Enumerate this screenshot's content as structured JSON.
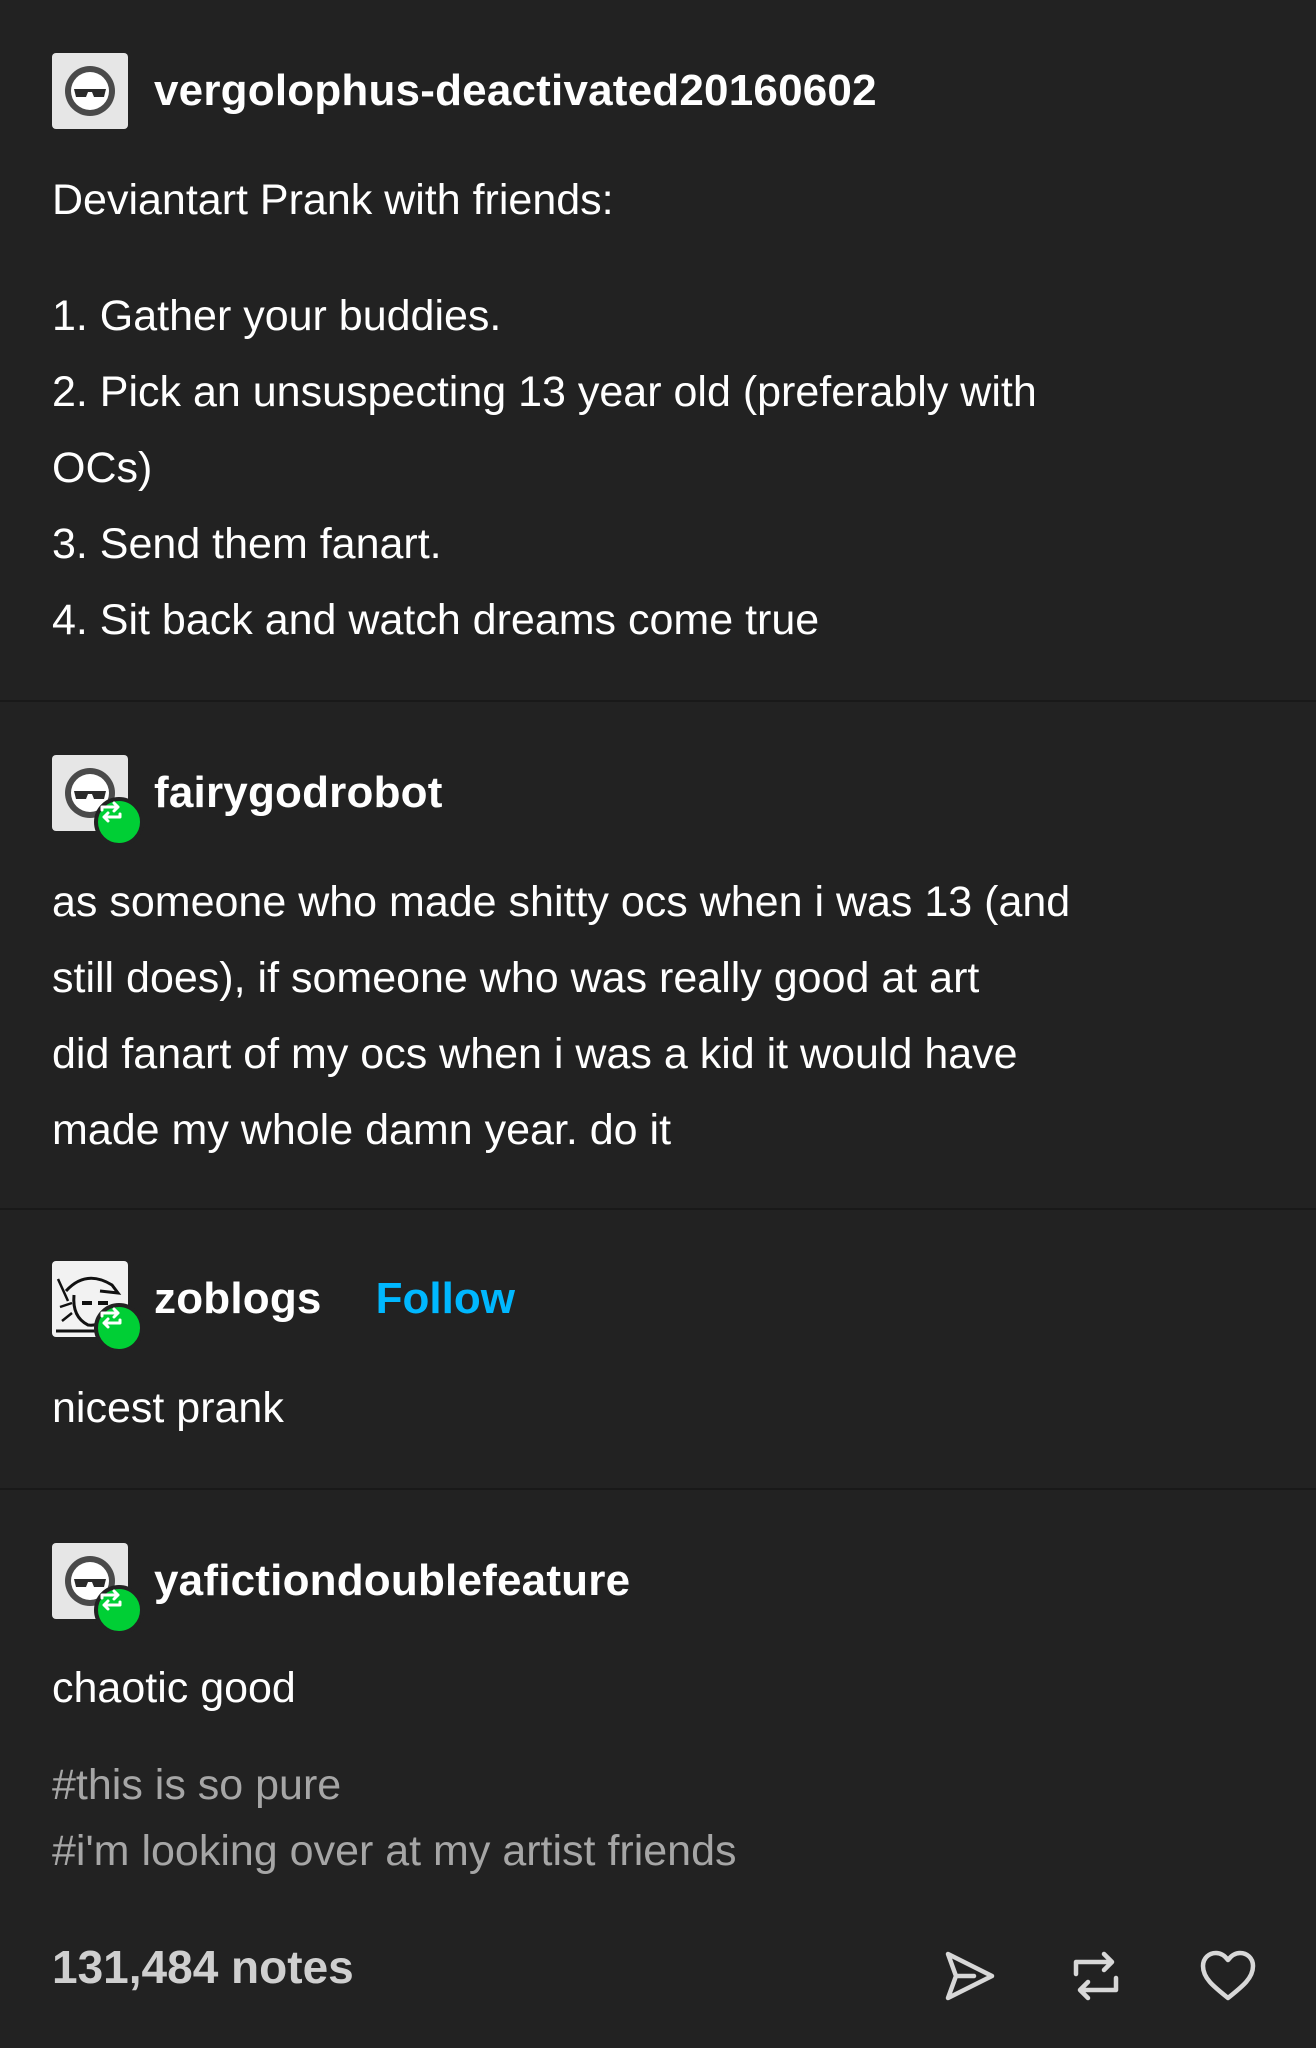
{
  "posts": [
    {
      "username": "vergolophus-deactivated20160602",
      "lines": [
        "Deviantart Prank with friends:",
        "1. Gather your buddies.",
        "2. Pick an unsuspecting 13 year old (preferably with",
        "OCs)",
        "3. Send them fanart.",
        "4. Sit back and watch dreams come true"
      ]
    },
    {
      "username": "fairygodrobot",
      "lines": [
        "as someone who made shitty ocs when i was 13 (and",
        "still does), if someone who was really good at art",
        "did fanart of my ocs when i was a kid it would have",
        "made my whole damn year. do it"
      ]
    },
    {
      "username": "zoblogs",
      "follow_label": "Follow",
      "lines": [
        "nicest prank"
      ]
    },
    {
      "username": "yafictiondoublefeature",
      "lines": [
        "chaotic good"
      ],
      "tags": [
        "#this is so pure",
        "#i'm looking over at my artist friends"
      ]
    }
  ],
  "footer": {
    "notes": "131,484 notes"
  },
  "colors": {
    "background": "#222222",
    "reblog_badge": "#00cf35",
    "follow": "#00b8ff",
    "tags": "#a6a6a6"
  },
  "icons": [
    "sunglasses-avatar-icon",
    "reblog-icon",
    "share-icon",
    "heart-icon"
  ]
}
